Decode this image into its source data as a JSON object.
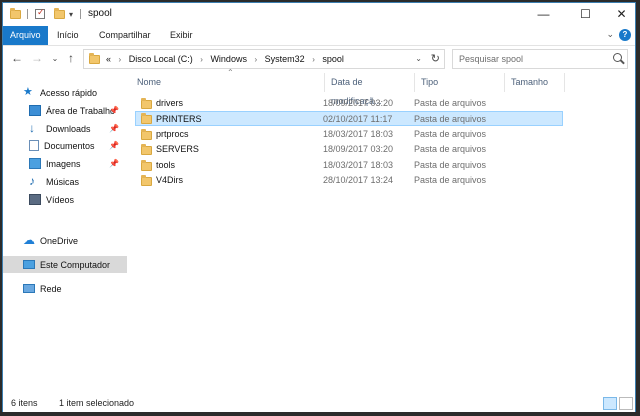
{
  "window": {
    "title": "spool",
    "controls": {
      "minimize": "—",
      "maximize": "☐",
      "close": "✕"
    }
  },
  "ribbon": {
    "tabs": [
      "Arquivo",
      "Início",
      "Compartilhar",
      "Exibir"
    ],
    "expand_icon": "chevron-down-icon",
    "help_icon": "?"
  },
  "address": {
    "prefix": "«",
    "crumbs": [
      "Disco Local (C:)",
      "Windows",
      "System32",
      "spool"
    ]
  },
  "search": {
    "placeholder": "Pesquisar spool"
  },
  "nav_pane": {
    "items": [
      {
        "label": "Acesso rápido",
        "icon": "star-icon",
        "pinned": false
      },
      {
        "label": "Área de Trabalhc",
        "icon": "desktop-icon",
        "pinned": true
      },
      {
        "label": "Downloads",
        "icon": "download-icon",
        "pinned": true
      },
      {
        "label": "Documentos",
        "icon": "documents-icon",
        "pinned": true
      },
      {
        "label": "Imagens",
        "icon": "images-icon",
        "pinned": true
      },
      {
        "label": "Músicas",
        "icon": "music-icon",
        "pinned": false
      },
      {
        "label": "Vídeos",
        "icon": "videos-icon",
        "pinned": false
      },
      {
        "label": "OneDrive",
        "icon": "cloud-icon",
        "pinned": false
      },
      {
        "label": "Este Computador",
        "icon": "computer-icon",
        "pinned": false,
        "selected": true
      },
      {
        "label": "Rede",
        "icon": "network-icon",
        "pinned": false
      }
    ]
  },
  "columns": [
    "Nome",
    "Data de modificaçã...",
    "Tipo",
    "Tamanho"
  ],
  "files": [
    {
      "name": "drivers",
      "date": "18/09/2017 03:20",
      "type": "Pasta de arquivos",
      "selected": false
    },
    {
      "name": "PRINTERS",
      "date": "02/10/2017 11:17",
      "type": "Pasta de arquivos",
      "selected": true
    },
    {
      "name": "prtprocs",
      "date": "18/03/2017 18:03",
      "type": "Pasta de arquivos",
      "selected": false
    },
    {
      "name": "SERVERS",
      "date": "18/09/2017 03:20",
      "type": "Pasta de arquivos",
      "selected": false
    },
    {
      "name": "tools",
      "date": "18/03/2017 18:03",
      "type": "Pasta de arquivos",
      "selected": false
    },
    {
      "name": "V4Dirs",
      "date": "28/10/2017 13:24",
      "type": "Pasta de arquivos",
      "selected": false
    }
  ],
  "status": {
    "item_count": "6 itens",
    "selection": "1 item selecionado"
  },
  "colors": {
    "accent": "#1979ca",
    "selection": "#cce8ff",
    "folder": "#f2c66b"
  }
}
